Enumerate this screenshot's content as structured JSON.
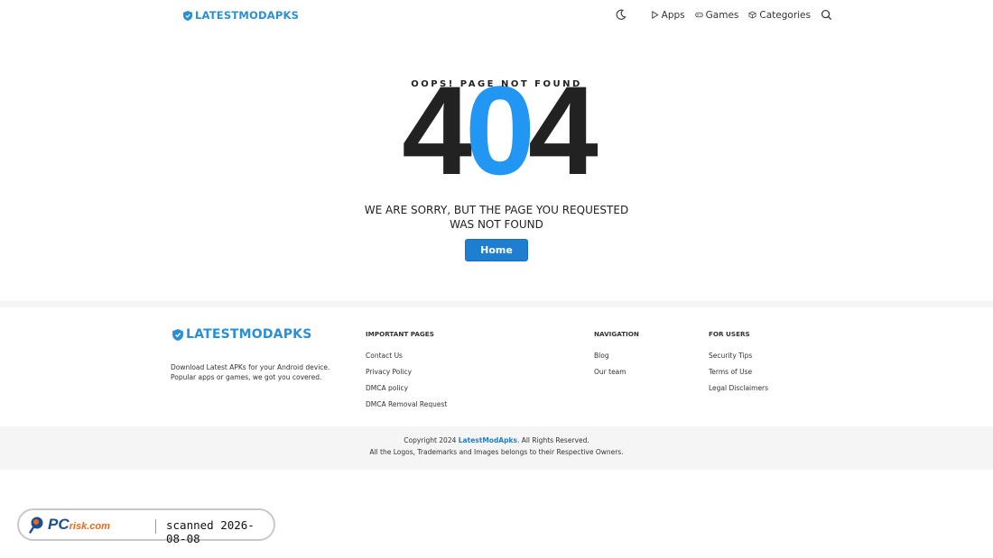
{
  "header": {
    "logo_text": "LATESTMODAPKS",
    "nav": [
      {
        "label": "Apps",
        "icon": "play-icon"
      },
      {
        "label": "Games",
        "icon": "gamepad-icon"
      },
      {
        "label": "Categories",
        "icon": "cube-icon"
      }
    ]
  },
  "error": {
    "oops": "OOPS! PAGE NOT FOUND",
    "code_left": "4",
    "code_mid": "0",
    "code_right": "4",
    "message_line1": "WE ARE SORRY, BUT THE PAGE YOU REQUESTED",
    "message_line2": "WAS NOT FOUND",
    "home_label": "Home"
  },
  "footer": {
    "logo_text": "LATESTMODAPKS",
    "desc_line1": "Download Latest APKs for your Android device.",
    "desc_line2": "Popular apps or games, we got you covered.",
    "columns": [
      {
        "title": "IMPORTANT PAGES",
        "links": [
          "Contact Us",
          "Privacy Policy",
          "DMCA policy",
          "DMCA Removal Request"
        ]
      },
      {
        "title": "NAVIGATION",
        "links": [
          "Blog",
          "Our team"
        ]
      },
      {
        "title": "FOR USERS",
        "links": [
          "Security Tips",
          "Terms of Use",
          "Legal Disclaimers"
        ]
      }
    ],
    "copyright_pre": "Copyright 2024",
    "copyright_brand": "LatestModApks",
    "copyright_post": ". All Rights Reserved.",
    "trademark": "All the Logos, Trademarks and Images belongs to their Respective Owners."
  },
  "watermark": {
    "logo_pc": "PC",
    "logo_risk": "risk.com",
    "scan_text": "scanned 2026-08-08"
  },
  "colors": {
    "brand": "#2a8fd6",
    "accent_zero": "#2196f3",
    "button": "#1e7fd0"
  }
}
